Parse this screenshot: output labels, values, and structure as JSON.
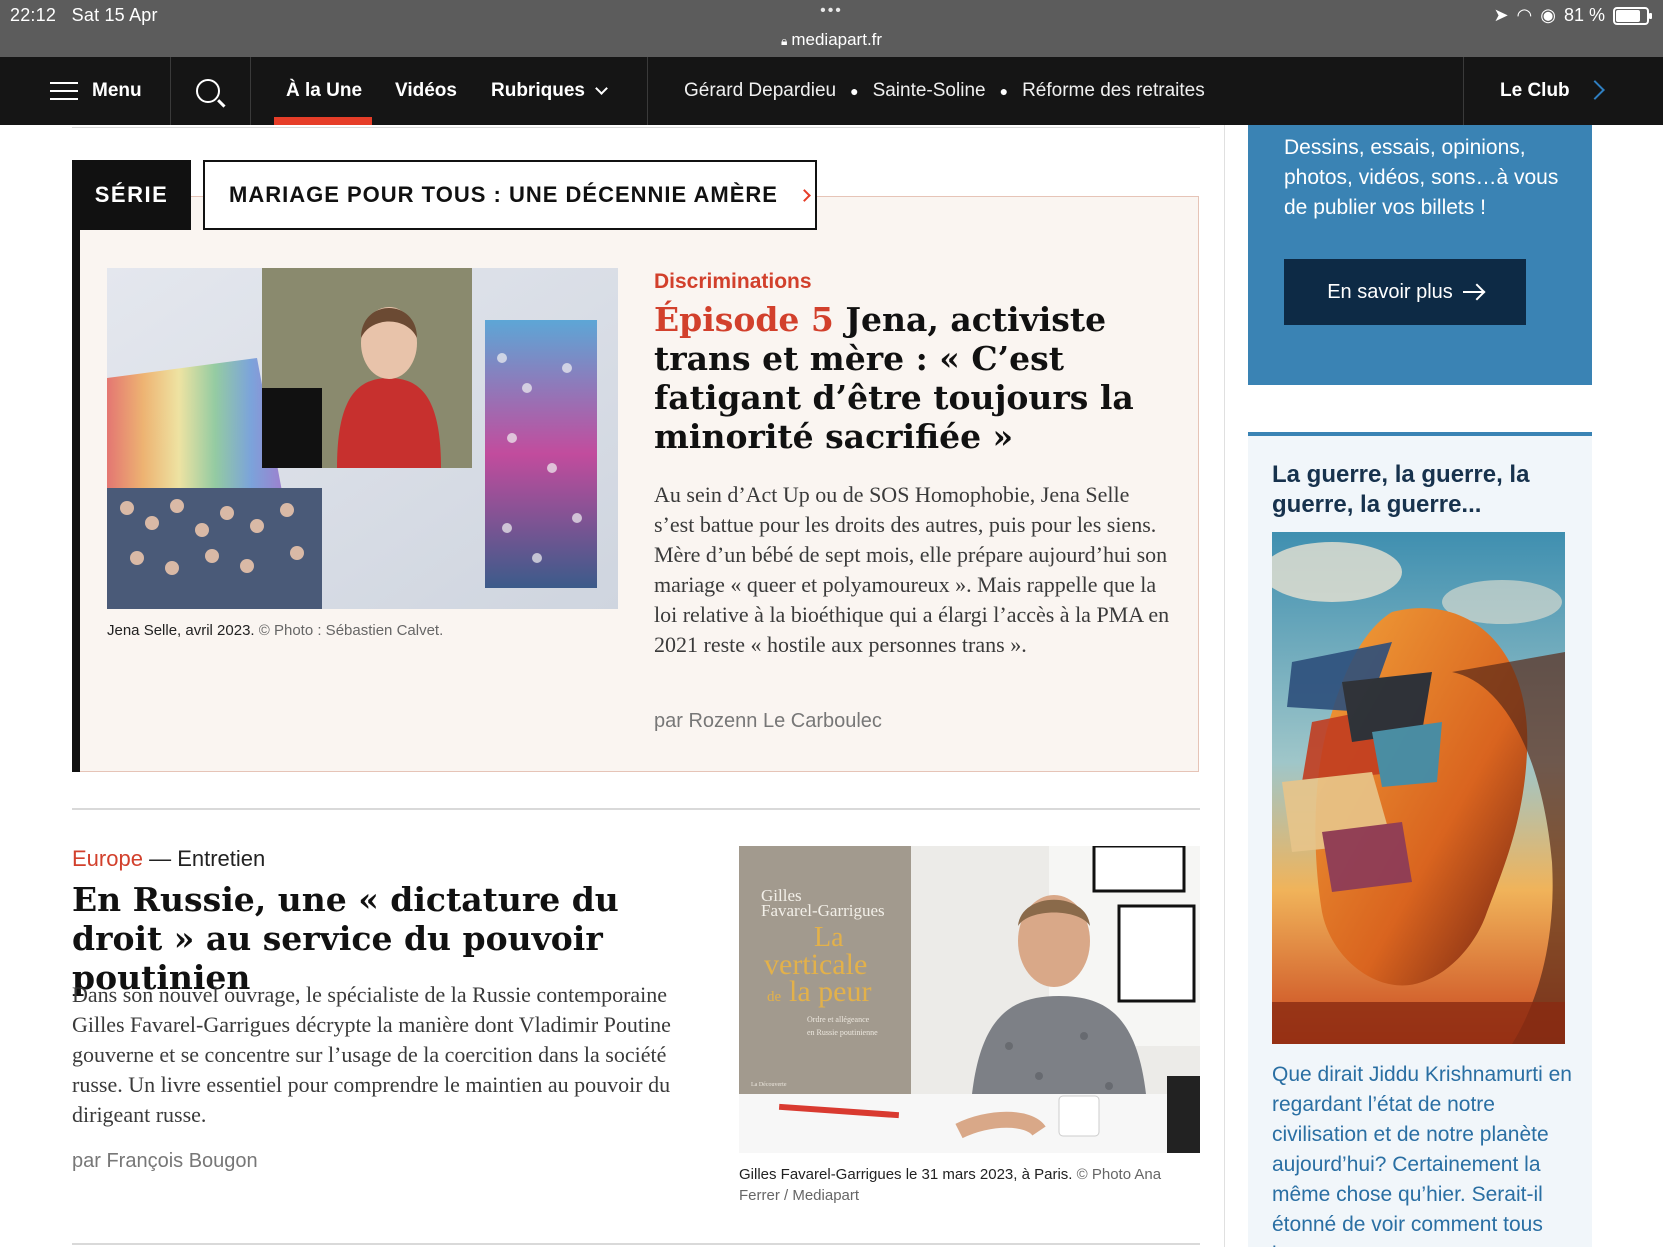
{
  "status_bar": {
    "time": "22:12",
    "date": "Sat 15 Apr",
    "dots": "•••",
    "url": "mediapart.fr",
    "battery": "81 %",
    "battery_level": 0.81
  },
  "nav": {
    "menu_label": "Menu",
    "links": [
      "À la Une",
      "Vidéos",
      "Rubriques"
    ],
    "active_link": "À la Une",
    "trending": [
      "Gérard Depardieu",
      "Sainte-Soline",
      "Réforme des retraites"
    ],
    "club_label": "Le Club"
  },
  "serie": {
    "tag": "SÉRIE",
    "title": "MARIAGE POUR TOUS : UNE DÉCENNIE AMÈRE"
  },
  "feature": {
    "caption": "Jena Selle, avril 2023.",
    "credit": "© Photo : Sébastien Calvet.",
    "kicker": "Discriminations",
    "episode": "Épisode 5",
    "headline": "Jena, activiste trans et mère : « C’est fatigant d’être toujours la minorité sacrifiée »",
    "lede": "Au sein d’Act Up ou de SOS Homophobie, Jena Selle s’est battue pour les droits des autres, puis pour les siens. Mère d’un bébé de sept mois, elle prépare aujourd’hui son mariage « queer et polyamoureux ». Mais rappelle que la loi relative à la bioéthique qui a élargi l’accès à la PMA en 2021 reste « hostile aux personnes trans ».",
    "byline": "par Rozenn Le Carboulec"
  },
  "article2": {
    "section": "Europe",
    "separator": " — ",
    "type": "Entretien",
    "headline": "En Russie, une « dictature du droit » au service du pouvoir poutinien",
    "lede": "Dans son nouvel ouvrage, le spécialiste de la Russie contemporaine Gilles Favarel-Garrigues décrypte la manière dont Vladimir Poutine gouverne et se concentre sur l’usage de la coercition dans la société russe. Un livre essentiel pour comprendre le maintien au pouvoir du dirigeant russe.",
    "byline": "par François Bougon",
    "caption": "Gilles Favarel-Garrigues le 31 mars 2023, à Paris.",
    "credit": "© Photo Ana Ferrer / Mediapart",
    "book": {
      "author_line1": "Gilles",
      "author_line2": "Favarel-Garrigues",
      "title_line1": "La",
      "title_line2": "verticale",
      "title_line3_small": "de",
      "title_line3": "la peur",
      "subtitle_line1": "Ordre et allégeance",
      "subtitle_line2": "en Russie poutinienne",
      "publisher": "La Découverte"
    }
  },
  "sidebar": {
    "promo_text": "Dessins, essais, opinions, photos, vidéos, sons…à vous de publier vos billets !",
    "promo_button": "En savoir plus",
    "blog_title": "La guerre, la guerre, la guerre, la guerre...",
    "blog_text": "Que dirait Jiddu Krishnamurti en regardant l’état de notre civilisation et de notre planète aujourd’hui? Certainement la même chose qu’hier. Serait-il étonné de voir comment tous les"
  },
  "colors": {
    "accent_red": "#d2402c",
    "nav_bg": "#151515",
    "club_blue": "#3a83b4",
    "serie_bg": "#faf5f1"
  }
}
